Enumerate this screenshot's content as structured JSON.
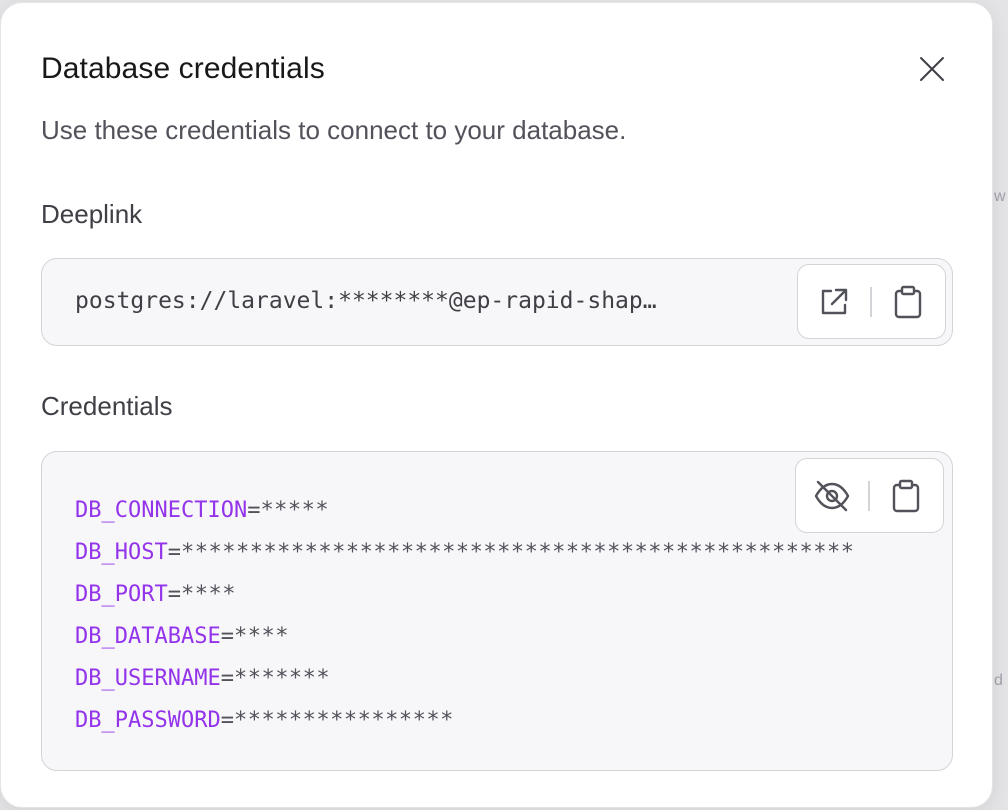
{
  "modal": {
    "title": "Database credentials",
    "subtitle": "Use these credentials to connect to your database."
  },
  "deeplink": {
    "label": "Deeplink",
    "value": "postgres://laravel:********@ep-rapid-shap…"
  },
  "credentials": {
    "label": "Credentials",
    "lines": [
      {
        "key": "DB_CONNECTION",
        "value": "*****"
      },
      {
        "key": "DB_HOST",
        "value": "*************************************************"
      },
      {
        "key": "DB_PORT",
        "value": "****"
      },
      {
        "key": "DB_DATABASE",
        "value": "****"
      },
      {
        "key": "DB_USERNAME",
        "value": "*******"
      },
      {
        "key": "DB_PASSWORD",
        "value": "****************"
      }
    ]
  },
  "icons": {
    "close": "close-icon",
    "open_link": "external-link-icon",
    "copy": "clipboard-icon",
    "toggle_visibility": "eye-off-icon"
  },
  "colors": {
    "accent_key": "#9333ea",
    "box_background": "#f7f7f9"
  }
}
